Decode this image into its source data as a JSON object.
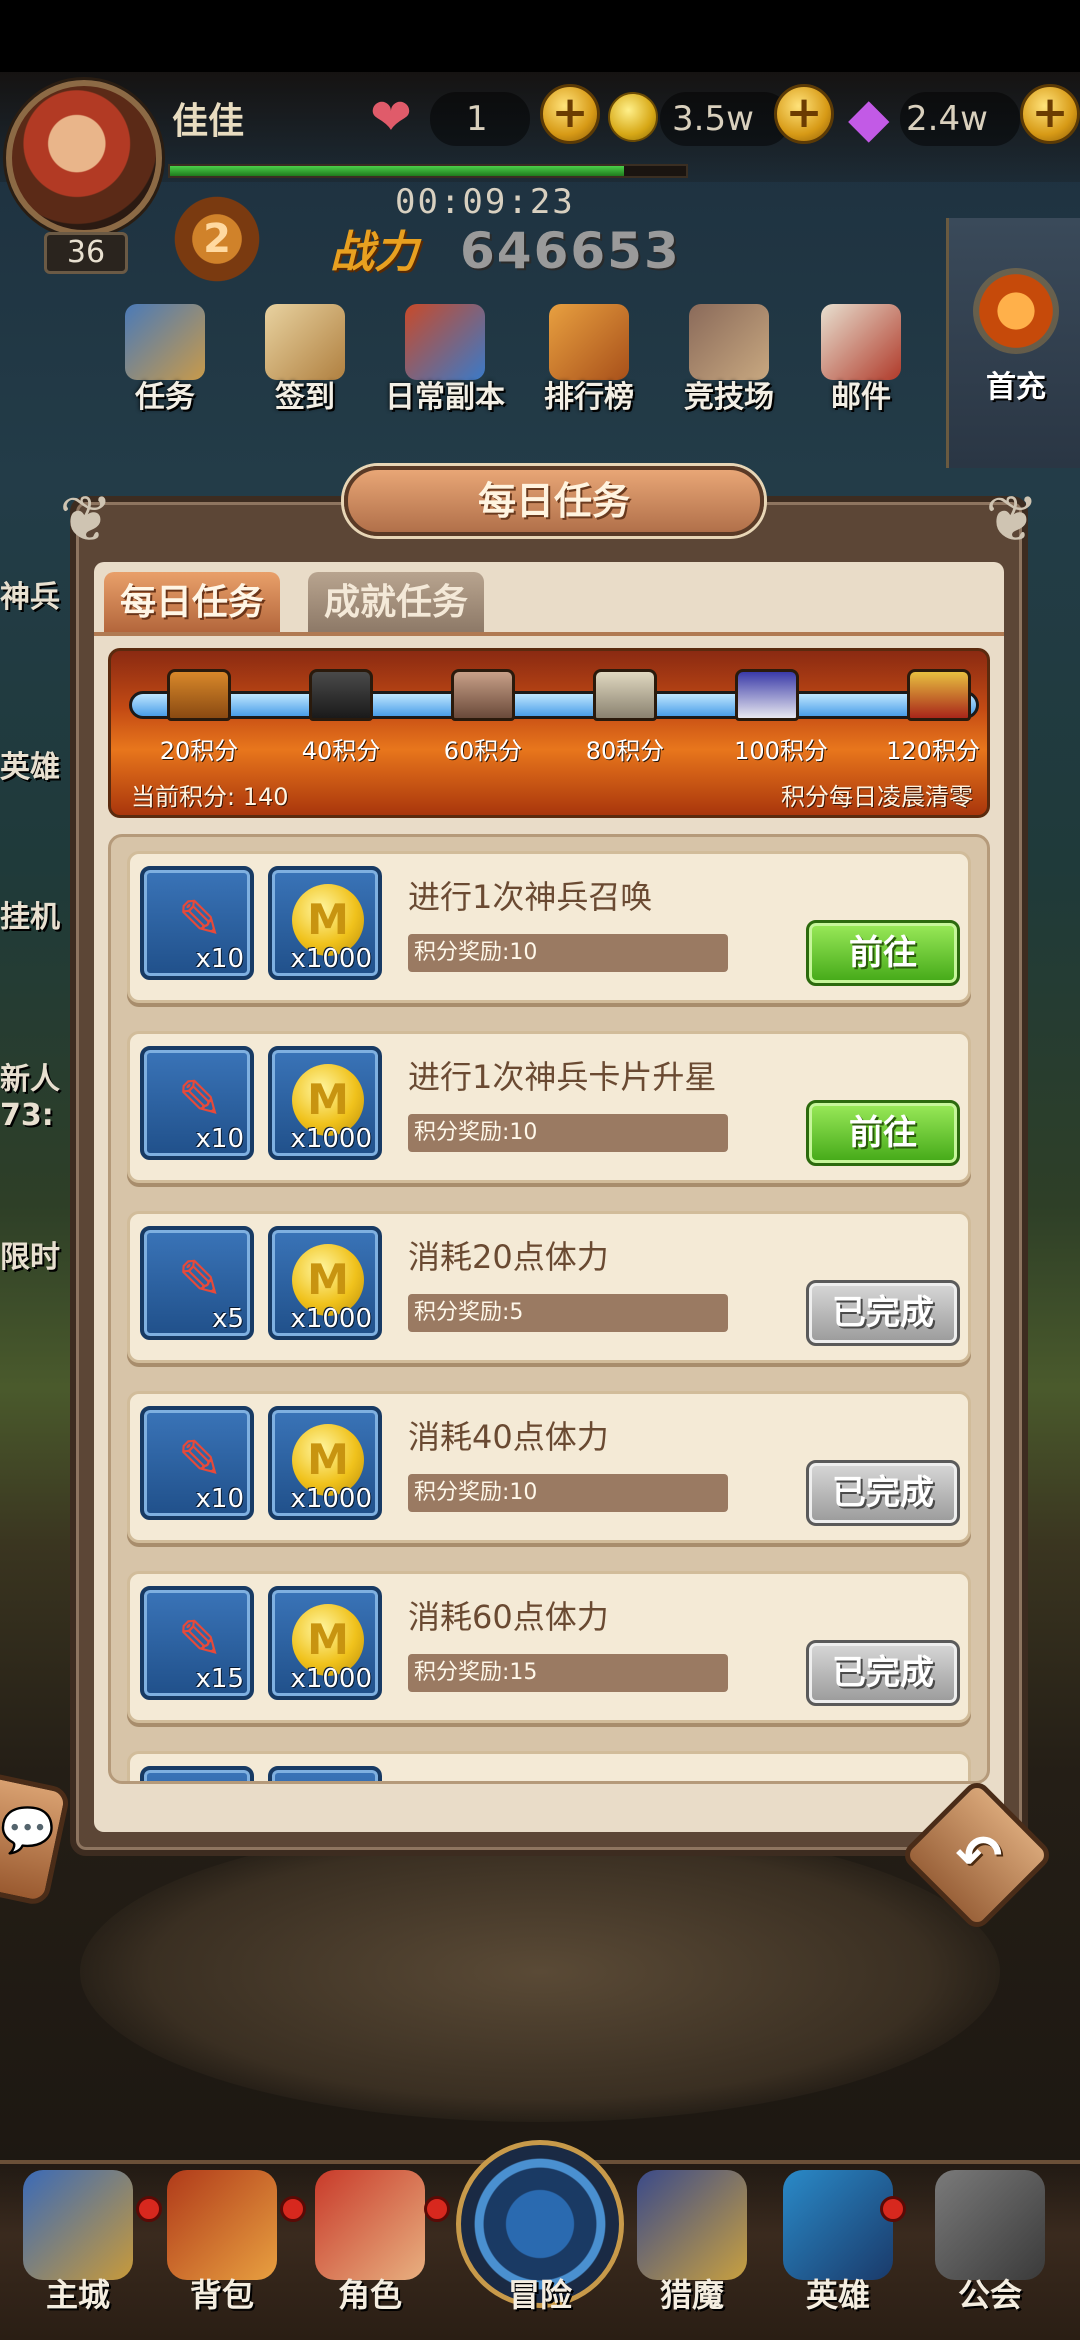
{
  "player": {
    "name": "佳佳",
    "level": "36",
    "stamina": "1",
    "gold": "3.5w",
    "gems": "2.4w",
    "timer": "00:09:23",
    "rank": "2",
    "power_label": "战力",
    "power": "646653"
  },
  "menu": [
    {
      "label": "任务",
      "icon": "task-book-icon"
    },
    {
      "label": "签到",
      "icon": "checkin-icon"
    },
    {
      "label": "日常副本",
      "icon": "daily-dungeon-icon"
    },
    {
      "label": "排行榜",
      "icon": "leaderboard-icon"
    },
    {
      "label": "竞技场",
      "icon": "arena-icon"
    },
    {
      "label": "邮件",
      "icon": "mail-icon"
    }
  ],
  "first_charge": {
    "label": "首充"
  },
  "side_labels": [
    "神兵",
    "英雄",
    "挂机",
    "新人",
    "73:",
    "限时"
  ],
  "modal": {
    "title": "每日任务",
    "tabs": [
      {
        "label": "每日任务",
        "active": true
      },
      {
        "label": "成就任务",
        "active": false
      }
    ],
    "progress": {
      "current_points_text": "当前积分: 140",
      "reset_note": "积分每日凌晨清零",
      "fill_fraction": 1.0,
      "milestones": [
        "20积分",
        "40积分",
        "60积分",
        "80积分",
        "100积分",
        "120积分"
      ]
    },
    "tasks": [
      {
        "title": "进行1次神兵召唤",
        "reward_text": "积分奖励:10",
        "items": [
          {
            "icon": "pencil-scroll-icon",
            "qty": "x10"
          },
          {
            "icon": "gold-coin-icon",
            "qty": "x1000"
          }
        ],
        "button": "前往",
        "status": "go"
      },
      {
        "title": "进行1次神兵卡片升星",
        "reward_text": "积分奖励:10",
        "items": [
          {
            "icon": "pencil-scroll-icon",
            "qty": "x10"
          },
          {
            "icon": "gold-coin-icon",
            "qty": "x1000"
          }
        ],
        "button": "前往",
        "status": "go"
      },
      {
        "title": "消耗20点体力",
        "reward_text": "积分奖励:5",
        "items": [
          {
            "icon": "pencil-scroll-icon",
            "qty": "x5"
          },
          {
            "icon": "gold-coin-icon",
            "qty": "x1000"
          }
        ],
        "button": "已完成",
        "status": "done"
      },
      {
        "title": "消耗40点体力",
        "reward_text": "积分奖励:10",
        "items": [
          {
            "icon": "pencil-scroll-icon",
            "qty": "x10"
          },
          {
            "icon": "gold-coin-icon",
            "qty": "x1000"
          }
        ],
        "button": "已完成",
        "status": "done"
      },
      {
        "title": "消耗60点体力",
        "reward_text": "积分奖励:15",
        "items": [
          {
            "icon": "pencil-scroll-icon",
            "qty": "x15"
          },
          {
            "icon": "gold-coin-icon",
            "qty": "x1000"
          }
        ],
        "button": "已完成",
        "status": "done"
      }
    ]
  },
  "bottom_nav": [
    {
      "label": "主城",
      "badge": true
    },
    {
      "label": "背包",
      "badge": true
    },
    {
      "label": "角色",
      "badge": true
    },
    {
      "label": "冒险",
      "badge": false
    },
    {
      "label": "猎魔",
      "badge": false
    },
    {
      "label": "英雄",
      "badge": true
    },
    {
      "label": "公会",
      "badge": false
    }
  ],
  "colors": {
    "go_button": "#43a817",
    "done_button": "#9a9a9a",
    "modal_frame": "#5c4636",
    "panel_bg": "#e9dcc8",
    "reward_slot": "#20508a"
  }
}
